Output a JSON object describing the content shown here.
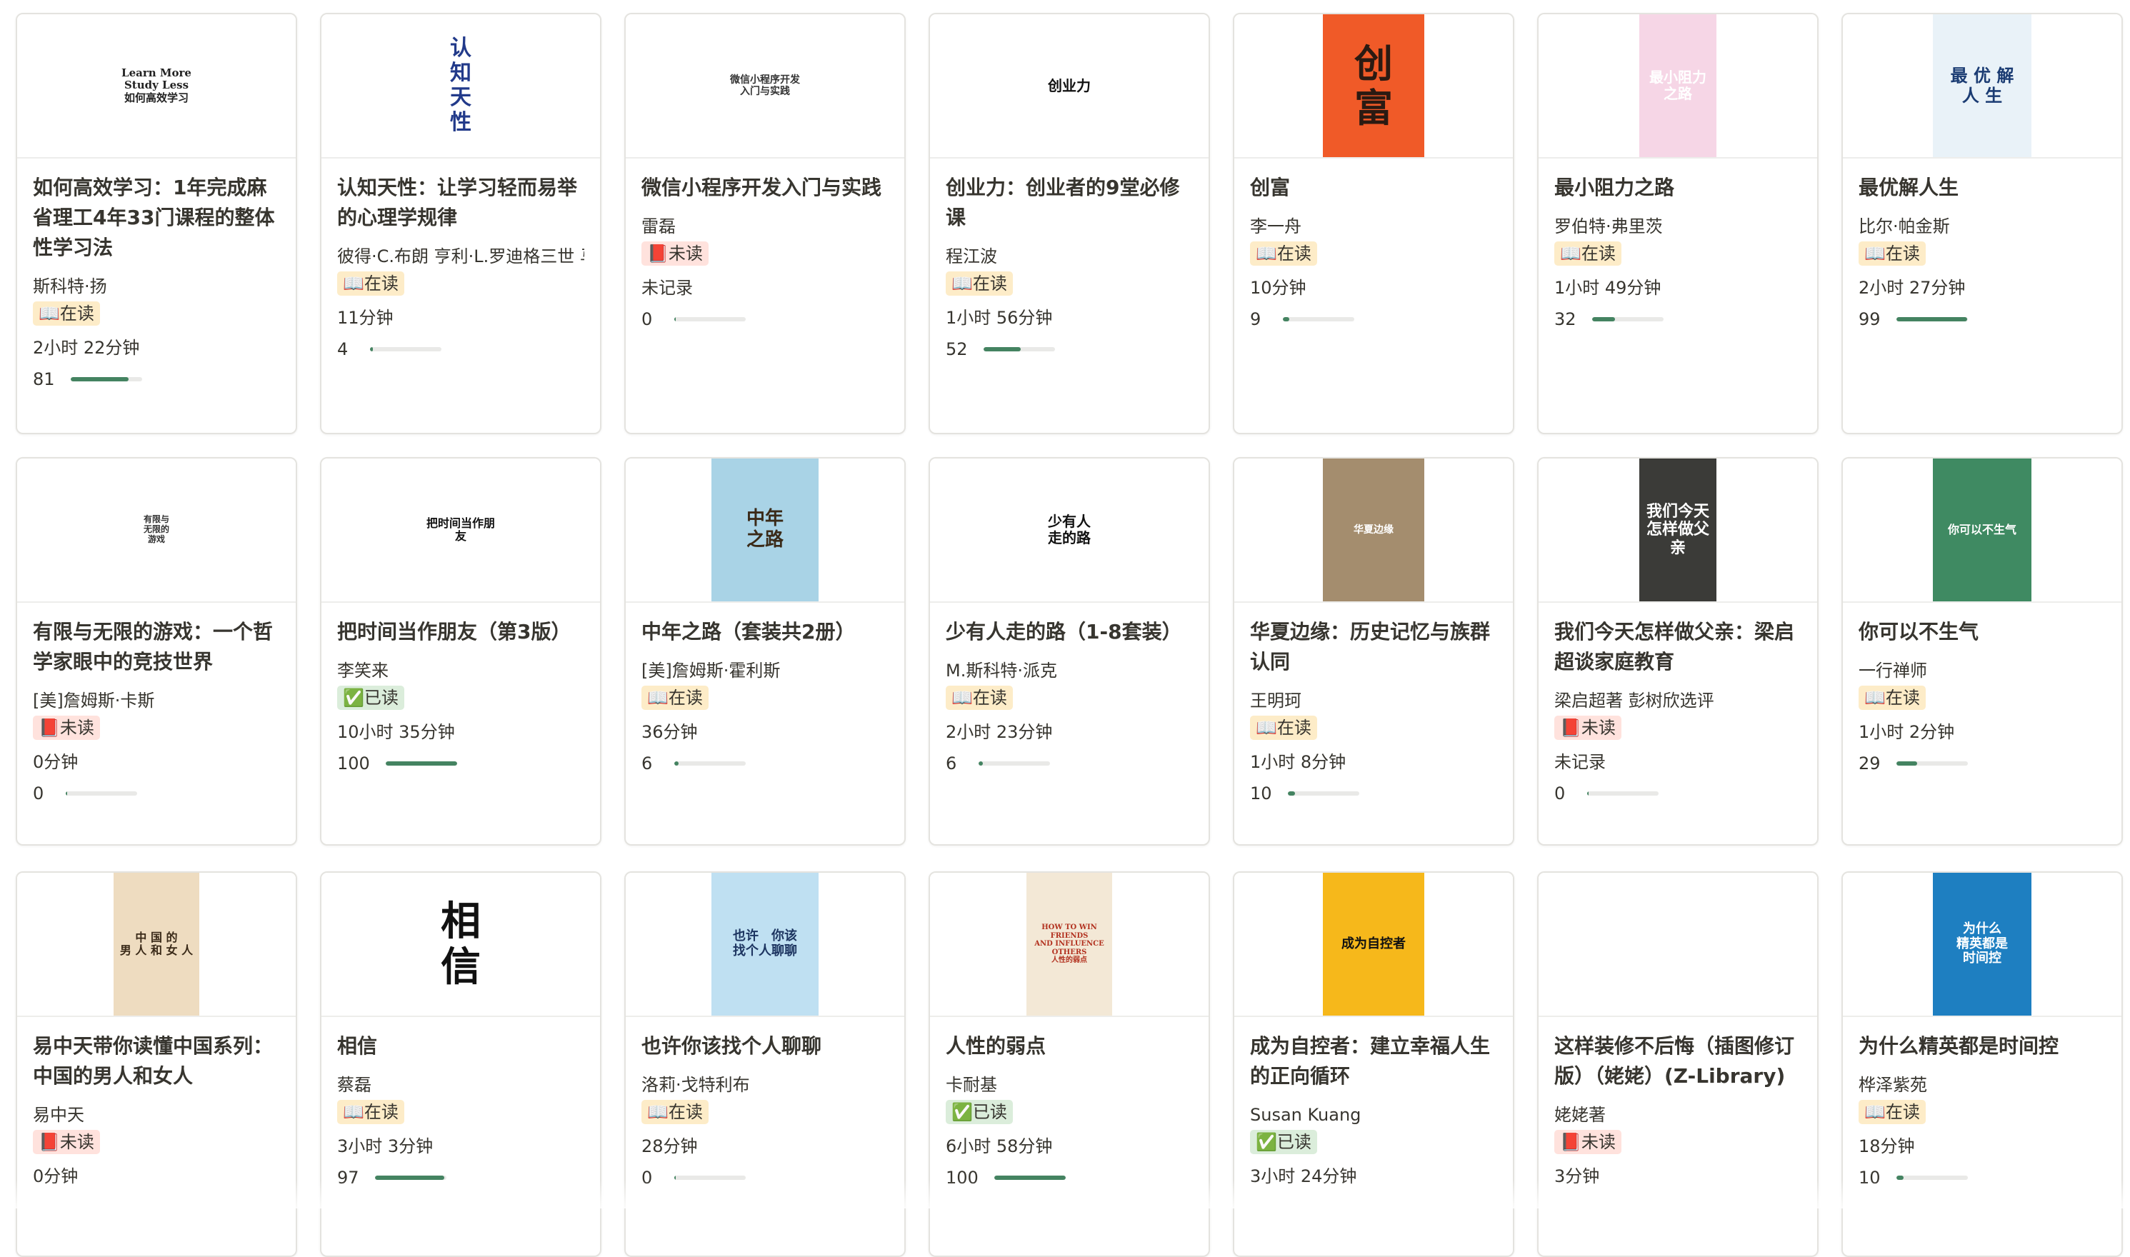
{
  "colors": {
    "progress_fill": "#448361",
    "progress_track": "#e9e9e7",
    "badge_reading_bg": "#fdecc8",
    "badge_unread_bg": "#ffe2dd",
    "badge_done_bg": "#dbeddb"
  },
  "books": [
    {
      "title": "如何高效学习：1年完成麻省理工4年33门课程的整体性学习法",
      "author": "斯科特·扬",
      "status": "📖在读",
      "status_type": "reading",
      "duration": "2小时 22分钟",
      "progress": 81,
      "cover": {
        "bg": "#ffffff",
        "fg": "#222222",
        "text": "Learn More\nStudy Less\n如何高效学习",
        "size": 15,
        "icon": "book-cover-person"
      }
    },
    {
      "title": "认知天性：让学习轻而易举的心理学规律",
      "author": "彼得·C.布朗 亨利·L.罗迪格三世 马克·A.麦克丹尼尔",
      "status": "📖在读",
      "status_type": "reading",
      "duration": "11分钟",
      "progress": 4,
      "cover": {
        "bg": "#ffffff",
        "fg": "#223a8a",
        "text": "认\n知\n天\n性",
        "size": 30,
        "icon": "book-cover-text"
      }
    },
    {
      "title": "微信小程序开发入门与实践",
      "author": "雷磊",
      "status": "📕未读",
      "status_type": "unread",
      "duration": "未记录",
      "progress": 0,
      "cover": {
        "bg": "#ffffff",
        "fg": "#333333",
        "text": "微信小程序开发\n入门与实践",
        "size": 14,
        "icon": "book-cover-figures"
      }
    },
    {
      "title": "创业力：创业者的9堂必修课",
      "author": "程江波",
      "status": "📖在读",
      "status_type": "reading",
      "duration": "1小时 56分钟",
      "progress": 52,
      "cover": {
        "bg": "#ffffff",
        "fg": "#111111",
        "text": "创业力",
        "size": 20,
        "icon": "book-cover-rocket"
      }
    },
    {
      "title": "创富",
      "author": "李一舟",
      "status": "📖在读",
      "status_type": "reading",
      "duration": "10分钟",
      "progress": 9,
      "cover": {
        "bg": "#f05a28",
        "fg": "#2b1a12",
        "text": "创\n富",
        "size": 54,
        "icon": "book-cover-text"
      }
    },
    {
      "title": "最小阻力之路",
      "author": "罗伯特·弗里茨",
      "status": "📖在读",
      "status_type": "reading",
      "duration": "1小时 49分钟",
      "progress": 32,
      "cover": {
        "bg": "#f6d6e6",
        "fg": "#ffffff",
        "text": "最小阻力之路",
        "size": 20,
        "icon": "book-cover-head"
      }
    },
    {
      "title": "最优解人生",
      "author": "比尔·帕金斯",
      "status": "📖在读",
      "status_type": "reading",
      "duration": "2小时 27分钟",
      "progress": 99,
      "cover": {
        "bg": "#e9f2f8",
        "fg": "#1b3c73",
        "text": "最 优 解\n人 生",
        "size": 24,
        "icon": "book-cover-waves"
      }
    },
    {
      "title": "有限与无限的游戏：一个哲学家眼中的竞技世界",
      "author": "[美]詹姆斯·卡斯",
      "status": "📕未读",
      "status_type": "unread",
      "duration": "0分钟",
      "progress": 0,
      "cover": {
        "bg": "#ffffff",
        "fg": "#333333",
        "text": "有限与\n无限的\n游戏",
        "size": 12,
        "icon": "book-cover-circles"
      }
    },
    {
      "title": "把时间当作朋友（第3版）",
      "author": "李笑来",
      "status": "✅已读",
      "status_type": "done",
      "duration": "10小时 35分钟",
      "progress": 100,
      "cover": {
        "bg": "#ffffff",
        "fg": "#111111",
        "text": "把时间当作朋友",
        "size": 16,
        "icon": "book-cover-text"
      }
    },
    {
      "title": "中年之路（套装共2册）",
      "author": "[美]詹姆斯·霍利斯",
      "status": "📖在读",
      "status_type": "reading",
      "duration": "36分钟",
      "progress": 6,
      "cover": {
        "bg": "#a9d3e6",
        "fg": "#3a2a18",
        "text": "中年\n之路",
        "size": 26,
        "icon": "book-cover-boxes"
      }
    },
    {
      "title": "少有人走的路（1-8套装）",
      "author": "M.斯科特·派克",
      "status": "📖在读",
      "status_type": "reading",
      "duration": "2小时 23分钟",
      "progress": 6,
      "cover": {
        "bg": "#ffffff",
        "fg": "#111111",
        "text": "少有人\n走的路",
        "size": 20,
        "icon": "book-cover-stack"
      }
    },
    {
      "title": "华夏边缘：历史记忆与族群认同",
      "author": "王明珂",
      "status": "📖在读",
      "status_type": "reading",
      "duration": "1小时 8分钟",
      "progress": 10,
      "cover": {
        "bg": "#a48d6e",
        "fg": "#ffffff",
        "text": "华夏边缘",
        "size": 14,
        "icon": "book-cover-flame"
      }
    },
    {
      "title": "我们今天怎样做父亲：梁启超谈家庭教育",
      "author": "梁启超著 彭树欣选评",
      "status": "📕未读",
      "status_type": "unread",
      "duration": "未记录",
      "progress": 0,
      "cover": {
        "bg": "#3b3b38",
        "fg": "#ffffff",
        "text": "我们今天\n怎样做父亲",
        "size": 22,
        "icon": "book-cover-text"
      }
    },
    {
      "title": "你可以不生气",
      "author": "一行禅师",
      "status": "📖在读",
      "status_type": "reading",
      "duration": "1小时 2分钟",
      "progress": 29,
      "cover": {
        "bg": "#3f8a62",
        "fg": "#ffffff",
        "text": "你可以不生气",
        "size": 16,
        "icon": "book-cover-monk"
      }
    },
    {
      "title": "易中天带你读懂中国系列：中国的男人和女人",
      "author": "易中天",
      "status": "📕未读",
      "status_type": "unread",
      "duration": "0分钟",
      "progress": null,
      "cover": {
        "bg": "#eedcc0",
        "fg": "#3a2a18",
        "text": "中 国 的\n男 人 和 女 人",
        "size": 16,
        "icon": "book-cover-text"
      }
    },
    {
      "title": "相信",
      "author": "蔡磊",
      "status": "📖在读",
      "status_type": "reading",
      "duration": "3小时 3分钟",
      "progress": 97,
      "cover": {
        "bg": "#ffffff",
        "fg": "#111111",
        "text": "相\n信",
        "size": 56,
        "icon": "book-cover-brush"
      }
    },
    {
      "title": "也许你该找个人聊聊",
      "author": "洛莉·戈特利布",
      "status": "📖在读",
      "status_type": "reading",
      "duration": "28分钟",
      "progress": 0,
      "cover": {
        "bg": "#bfe0f2",
        "fg": "#1d3561",
        "text": "也许　你该\n找个人聊聊",
        "size": 18,
        "icon": "book-cover-chairs"
      }
    },
    {
      "title": "人性的弱点",
      "author": "卡耐基",
      "status": "✅已读",
      "status_type": "done",
      "duration": "6小时 58分钟",
      "progress": 100,
      "cover": {
        "bg": "#f3e8d6",
        "fg": "#b2311f",
        "text": "HOW TO WIN FRIENDS\nAND INFLUENCE\nOTHERS\n人性的弱点",
        "size": 10,
        "icon": "book-cover-portrait"
      }
    },
    {
      "title": "成为自控者：建立幸福人生的正向循环",
      "author": "Susan Kuang",
      "status": "✅已读",
      "status_type": "done",
      "duration": "3小时 24分钟",
      "progress": null,
      "cover": {
        "bg": "#f6b81b",
        "fg": "#111111",
        "text": "成为自控者",
        "size": 18,
        "icon": "book-cover-seal"
      }
    },
    {
      "title": "这样装修不后悔（插图修订版）（姥姥）(Z-Library)",
      "author": "姥姥著",
      "status": "📕未读",
      "status_type": "unread",
      "duration": "3分钟",
      "progress": null,
      "cover": null
    },
    {
      "title": "为什么精英都是时间控",
      "author": "桦泽紫苑",
      "status": "📖在读",
      "status_type": "reading",
      "duration": "18分钟",
      "progress": 10,
      "cover": {
        "bg": "#1e7fc1",
        "fg": "#ffffff",
        "text": "为什么\n精英都是\n时间控",
        "size": 18,
        "icon": "book-cover-hourglass"
      }
    }
  ]
}
